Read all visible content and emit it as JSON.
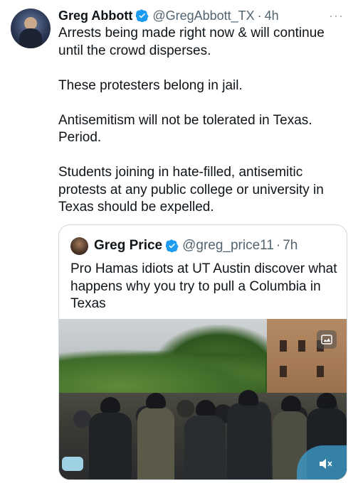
{
  "tweet": {
    "author_name": "Greg Abbott",
    "author_handle": "@GregAbbott_TX",
    "separator": "·",
    "time": "4h",
    "more_label": "···",
    "paragraphs": [
      "Arrests being made right now & will continue until the crowd disperses.",
      "These protesters belong in jail.",
      "Antisemitism will not be tolerated in Texas. Period.",
      "Students joining in hate-filled, antisemitic protests at any public college or university in Texas should be expelled."
    ]
  },
  "quote": {
    "author_name": "Greg Price",
    "author_handle": "@greg_price11",
    "separator": "·",
    "time": "7h",
    "text": "Pro Hamas idiots at UT Austin discover what happens why you try to pull a Columbia in Texas"
  },
  "icons": {
    "verified": "verified-badge-icon",
    "more": "more-icon",
    "media_corner": "media-tag-icon",
    "mute": "mute-icon"
  },
  "colors": {
    "verified": "#1d9bf0",
    "text": "#0f1419",
    "secondary": "#536471",
    "border": "#cfd9de"
  }
}
